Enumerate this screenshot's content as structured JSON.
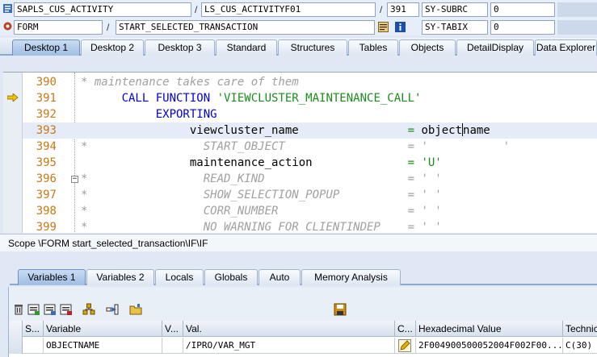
{
  "header": {
    "program": "SAPLS_CUS_ACTIVITY",
    "include": "LS_CUS_ACTIVITYF01",
    "line_no": "391",
    "sys_var1_name": "SY-SUBRC",
    "sys_var1_value": "0",
    "event_type": "FORM",
    "event_name": "START_SELECTED_TRANSACTION",
    "sys_var2_name": "SY-TABIX",
    "sys_var2_value": "0",
    "separator": "/"
  },
  "desktop_tabs": [
    "Desktop 1",
    "Desktop 2",
    "Desktop 3",
    "Standard",
    "Structures",
    "Tables",
    "Objects",
    "DetailDisplay",
    "Data Explorer"
  ],
  "editor": {
    "lines": [
      {
        "no": "390",
        "parts": [
          {
            "t": "* maintenance takes care of them",
            "c": "cmt"
          }
        ]
      },
      {
        "no": "391",
        "parts": [
          {
            "t": "      CALL FUNCTION ",
            "c": "kw"
          },
          {
            "t": "'VIEWCLUSTER_MAINTENANCE_CALL'",
            "c": "str"
          }
        ]
      },
      {
        "no": "392",
        "parts": [
          {
            "t": "           EXPORTING",
            "c": "kw"
          }
        ]
      },
      {
        "no": "393",
        "parts": [
          {
            "t": "                viewcluster_name",
            "c": ""
          },
          {
            "t": "                = ",
            "c": "str"
          },
          {
            "t": "object",
            "c": ""
          },
          {
            "t": "name",
            "c": ""
          }
        ]
      },
      {
        "no": "394",
        "parts": [
          {
            "t": "*                 START_OBJECT",
            "c": "cmt"
          },
          {
            "t": "                  = '           '",
            "c": "cmt"
          }
        ]
      },
      {
        "no": "395",
        "parts": [
          {
            "t": "                maintenance_action",
            "c": ""
          },
          {
            "t": "              = ",
            "c": "str"
          },
          {
            "t": "'U'",
            "c": "str"
          }
        ]
      },
      {
        "no": "396",
        "parts": [
          {
            "t": "*                 READ_KIND",
            "c": "cmt"
          },
          {
            "t": "                     = ' '",
            "c": "cmt"
          }
        ]
      },
      {
        "no": "397",
        "parts": [
          {
            "t": "*                 SHOW_SELECTION_POPUP",
            "c": "cmt"
          },
          {
            "t": "          = ' '",
            "c": "cmt"
          }
        ]
      },
      {
        "no": "398",
        "parts": [
          {
            "t": "*                 CORR_NUMBER",
            "c": "cmt"
          },
          {
            "t": "                   = ' '",
            "c": "cmt"
          }
        ]
      },
      {
        "no": "399",
        "parts": [
          {
            "t": "*                 NO_WARNING_FOR_CLIENTINDEP",
            "c": "cmt"
          },
          {
            "t": "    = ' '",
            "c": "cmt"
          }
        ]
      }
    ]
  },
  "scope": "Scope \\FORM start_selected_transaction\\IF\\IF",
  "variable_tabs": [
    "Variables 1",
    "Variables 2",
    "Locals",
    "Globals",
    "Auto",
    "Memory Analysis"
  ],
  "grid": {
    "headers": [
      "S...",
      "Variable",
      "V...",
      "Val.",
      "C...",
      "Hexadecimal Value",
      "Technic"
    ],
    "row": [
      "",
      "OBJECTNAME",
      "",
      "/IPRO/VAR_MGT",
      "",
      "2F004900500052004F002F00...",
      "C(30)"
    ]
  },
  "colors": {
    "accent": "#9fbde3",
    "keyword": "#0000e0",
    "string": "#1c8c1c",
    "comment": "#a0a0a0",
    "line_number": "#c87814"
  }
}
